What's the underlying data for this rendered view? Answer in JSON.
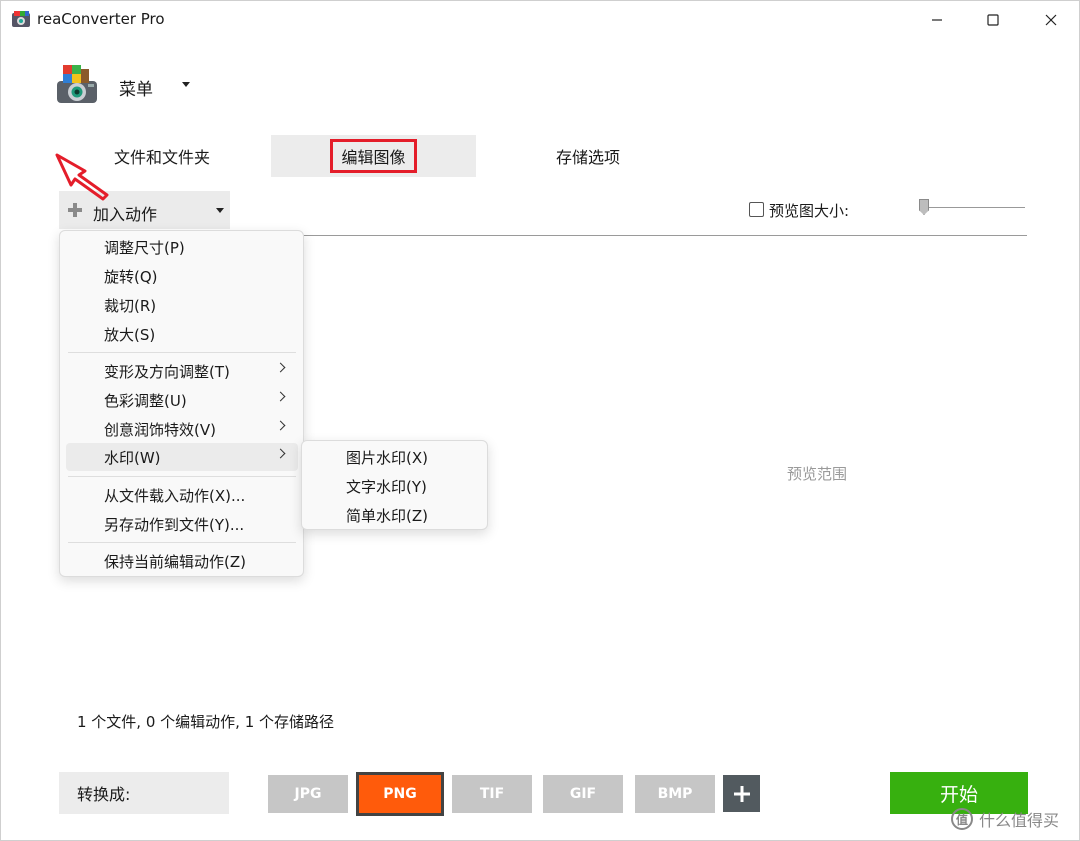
{
  "window": {
    "title": "reaConverter Pro",
    "icons": {
      "app": "reaconverter-app-icon",
      "minimize": "minimize-icon",
      "maximize": "maximize-icon",
      "close": "close-icon"
    }
  },
  "app_menu": {
    "label": "菜单",
    "icon": "reaconverter-logo-icon"
  },
  "tabs": [
    {
      "label": "文件和文件夹",
      "selected": false
    },
    {
      "label": "编辑图像",
      "selected": true
    },
    {
      "label": "存储选项",
      "selected": false
    }
  ],
  "toolbar": {
    "add_action_label": "加入动作",
    "preview_size_label": "预览图大小:",
    "preview_size_checked": false
  },
  "add_action_menu": {
    "items": [
      {
        "label": "调整尺寸(P)"
      },
      {
        "label": "旋转(Q)"
      },
      {
        "label": "裁切(R)"
      },
      {
        "label": "放大(S)"
      },
      {
        "label": "变形及方向调整(T)"
      },
      {
        "label": "色彩调整(U)"
      },
      {
        "label": "创意润饰特效(V)"
      },
      {
        "label": "水印(W)"
      },
      {
        "label": "从文件载入动作(X)..."
      },
      {
        "label": "另存动作到文件(Y)..."
      },
      {
        "label": "保持当前编辑动作(Z)"
      }
    ],
    "submenu_watermark": [
      {
        "label": "图片水印(X)"
      },
      {
        "label": "文字水印(Y)"
      },
      {
        "label": "简单水印(Z)"
      }
    ]
  },
  "preview_area": {
    "placeholder": "预览范围"
  },
  "status": {
    "text": "1 个文件, 0 个编辑动作, 1 个存储路径"
  },
  "bottom": {
    "convert_to_label": "转换成:",
    "formats": [
      {
        "label": "JPG",
        "selected": false
      },
      {
        "label": "PNG",
        "selected": true
      },
      {
        "label": "TIF",
        "selected": false
      },
      {
        "label": "GIF",
        "selected": false
      },
      {
        "label": "BMP",
        "selected": false
      }
    ],
    "add_format_icon": "plus-icon",
    "start_label": "开始"
  },
  "watermark": {
    "text": "什么值得买",
    "icon_text": "值"
  },
  "colors": {
    "accent_green": "#37b00f",
    "selected_format": "#ff5b0b",
    "highlight_red": "#e41d2a",
    "format_gray": "#c6c6c6"
  }
}
